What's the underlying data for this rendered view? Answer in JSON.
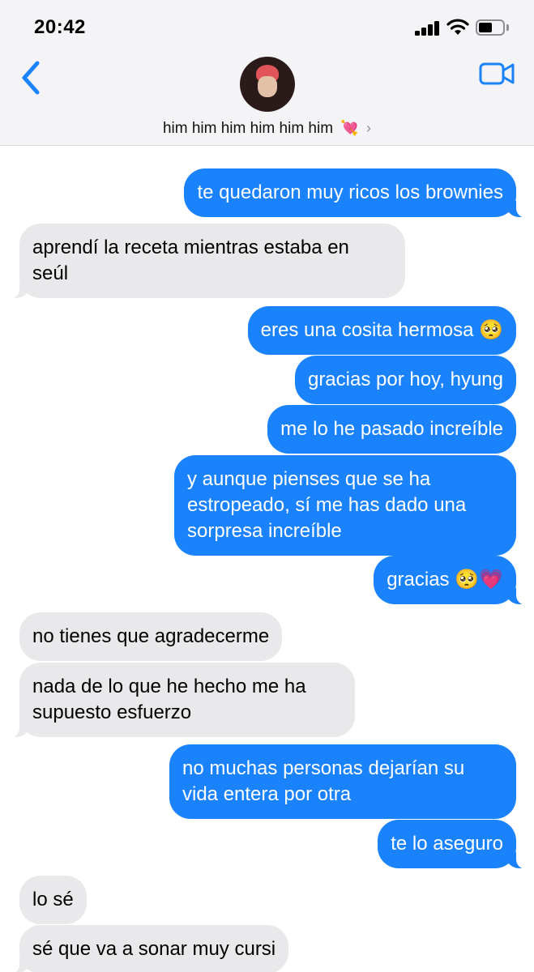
{
  "status_bar": {
    "time": "20:42"
  },
  "header": {
    "contact_name": "him him him him him him",
    "name_emoji": "💘",
    "chevron": "›",
    "back_icon": "chevron-left-icon",
    "video_icon": "video-camera-icon",
    "accent_color": "#1a82fb"
  },
  "messages": [
    {
      "from": "me",
      "text": "te quedaron muy ricos los brownies"
    },
    {
      "from": "them",
      "line1": "aprendí la receta mientras estaba en",
      "line2": "seúl"
    },
    {
      "from": "me",
      "text": "eres una cosita hermosa",
      "emoji": "🥺"
    },
    {
      "from": "me",
      "text": "gracias por hoy, hyung"
    },
    {
      "from": "me",
      "text": "me lo he pasado increíble"
    },
    {
      "from": "me",
      "line1": "y aunque pienses que se ha",
      "line2": "estropeado, sí me has dado una",
      "line3": "sorpresa increíble"
    },
    {
      "from": "me",
      "text": "gracias",
      "emoji": "🥺💗"
    },
    {
      "from": "them",
      "text": "no tienes que agradecerme"
    },
    {
      "from": "them",
      "line1": "nada de lo que he hecho me ha",
      "line2": "supuesto esfuerzo"
    },
    {
      "from": "me",
      "line1": "no muchas personas dejarían su",
      "line2": "vida entera por otra"
    },
    {
      "from": "me",
      "text": "te lo aseguro"
    },
    {
      "from": "them",
      "text": "lo sé"
    },
    {
      "from": "them",
      "text": "sé que va a sonar muy cursi"
    }
  ],
  "colors": {
    "sent_bubble": "#1a82fb",
    "received_bubble": "#e9e9eb",
    "header_bg": "#f4f4f6"
  }
}
